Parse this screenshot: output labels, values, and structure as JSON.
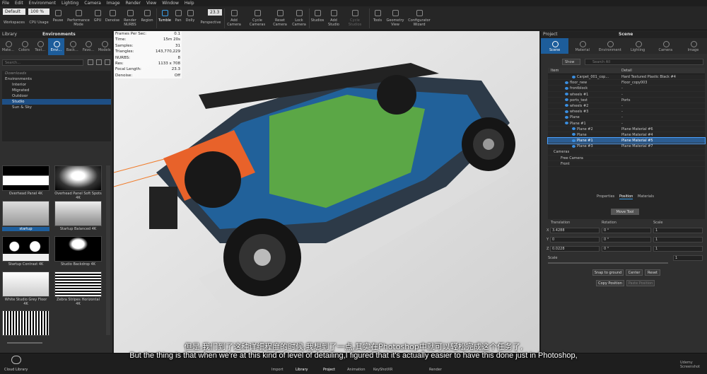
{
  "menu": [
    "File",
    "Edit",
    "Environment",
    "Lighting",
    "Camera",
    "Image",
    "Render",
    "View",
    "Window",
    "Help"
  ],
  "toolbar": {
    "mode_value": "Default",
    "cpu_value": "100 %",
    "cam_value": "23.3",
    "items": [
      "Workspaces",
      "CPU Usage",
      "Pause",
      "Performance Mode",
      "GPU",
      "Denoise",
      "Render NURBS",
      "Region",
      "Tumble",
      "Pan",
      "Dolly",
      "Perspective",
      "Add Camera",
      "Cycle Cameras",
      "Reset Camera",
      "Lock Camera",
      "Studios",
      "Add Studio",
      "Cycle Studios",
      "Tools",
      "Geometry View",
      "Configurator Wizard"
    ]
  },
  "library": {
    "header": "Library",
    "title": "Environments",
    "tabs": [
      "Mate...",
      "Colors",
      "Text...",
      "Envi...",
      "Back...",
      "Favo...",
      "Models"
    ],
    "search_placeholder": "Search...",
    "tree": [
      "Downloads",
      "Environments",
      "Interior",
      "Migrated",
      "Outdoor",
      "Studio",
      "Sun & Sky"
    ],
    "thumbs": [
      {
        "label": "Overhead Panel 4K"
      },
      {
        "label": "Overhead Panel Soft Spots 4K"
      },
      {
        "label": "startup"
      },
      {
        "label": "Startup Balanced 4K"
      },
      {
        "label": "Startup Contrast 4K"
      },
      {
        "label": "Studio Backdrop 4K"
      },
      {
        "label": "White Studio Grey Floor 4K"
      },
      {
        "label": "Zebra Stripes Horizontal 4K"
      }
    ]
  },
  "stats": [
    {
      "k": "Frames Per Sec:",
      "v": "0.1"
    },
    {
      "k": "Time:",
      "v": "15m 20s"
    },
    {
      "k": "Samples:",
      "v": "31"
    },
    {
      "k": "Triangles:",
      "v": "143,770,229"
    },
    {
      "k": "NURBS:",
      "v": "8"
    },
    {
      "k": "Res:",
      "v": "1133 x 708"
    },
    {
      "k": "Focal Length:",
      "v": "23.3"
    },
    {
      "k": "Denoise:",
      "v": "Off"
    }
  ],
  "scene": {
    "header": "Project",
    "title": "Scene",
    "tabs": [
      "Scene",
      "Material",
      "Environment",
      "Lighting",
      "Camera",
      "Image"
    ],
    "show_label": "Show",
    "search_placeholder": "Search All",
    "col_item": "Item",
    "col_detail": "Detail",
    "rows": [
      {
        "item": "Carpet_001_cop...",
        "detail": "Hard Textured Plastic Black #4"
      },
      {
        "item": "floor_new",
        "detail": "Floor_copy003"
      },
      {
        "item": "frontblock",
        "detail": "-"
      },
      {
        "item": "wheels #1",
        "detail": "-"
      },
      {
        "item": "ports_test",
        "detail": "Ports"
      },
      {
        "item": "wheels #2",
        "detail": "-"
      },
      {
        "item": "wheels #3",
        "detail": "-"
      },
      {
        "item": "Plane",
        "detail": "-"
      },
      {
        "item": "Plane #1",
        "detail": "-"
      },
      {
        "item": "Plane #2",
        "detail": "Plane Material #6"
      },
      {
        "item": "Plane",
        "detail": "Plane Material #4"
      },
      {
        "item": "Plane #1",
        "detail": "Plane Material #5"
      },
      {
        "item": "Plane #3",
        "detail": "Plane Material #7"
      },
      {
        "item": "Cameras",
        "detail": ""
      },
      {
        "item": "Free Camera",
        "detail": ""
      },
      {
        "item": "Front",
        "detail": ""
      }
    ],
    "props_tabs": [
      "Properties",
      "Position",
      "Materials"
    ],
    "move_tool": "Move Tool",
    "translation": "Translation",
    "rotation": "Rotation",
    "scale_lbl": "Scale",
    "x": {
      "t": "3.4288",
      "r": "0 °",
      "s": "1"
    },
    "y": {
      "t": "0",
      "r": "0 °",
      "s": "1"
    },
    "z": {
      "t": "0.0228",
      "r": "0 °",
      "s": "1"
    },
    "scale_value": "1",
    "snap": "Snap to ground",
    "center": "Center",
    "reset": "Reset",
    "copy_pos": "Copy Position",
    "paste_pos": "Paste Position"
  },
  "bottom": [
    "Import",
    "Library",
    "Project",
    "Animation",
    "KeyShotXR",
    "Render"
  ],
  "cloud": "Cloud Library",
  "subtitle_cn": "但是,我们到了这种详细程度的时候,我想到了一点,其实在Photoshop中就可以轻松完成这个任务了,",
  "subtitle_en": "But the thing is that when we're at this kind of level of detailing,I figured that it's actually easier to have this done just in Photoshop,",
  "watermark": "Udemy Screenshot"
}
